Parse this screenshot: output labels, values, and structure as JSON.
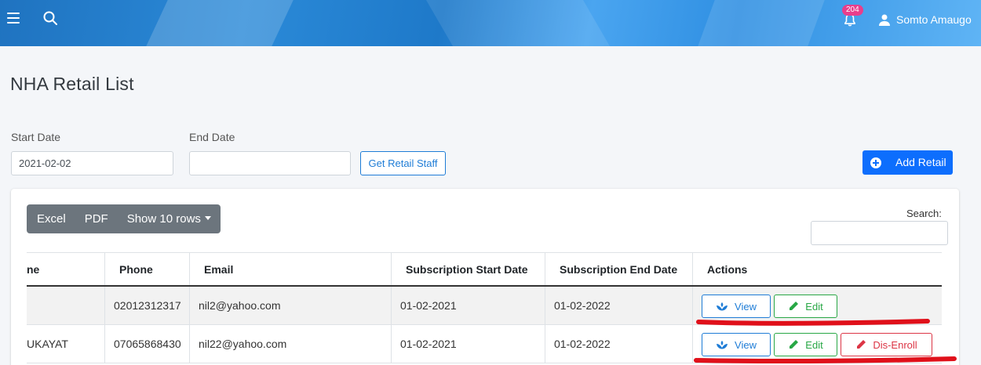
{
  "topbar": {
    "notification_count": "204",
    "user_name": "Somto Amaugo",
    "gradient_colors": [
      "#1f73c0",
      "#5fb4f5"
    ]
  },
  "page": {
    "title": "NHA Retail List"
  },
  "filters": {
    "start_label": "Start Date",
    "start_value": "2021-02-02",
    "end_label": "End Date",
    "end_value": "",
    "get_button": "Get Retail Staff",
    "add_button": "Add Retail"
  },
  "toolbar": {
    "excel": "Excel",
    "pdf": "PDF",
    "show_rows": "Show 10 rows",
    "search_label": "Search:"
  },
  "table": {
    "columns": [
      "ne",
      "Phone",
      "Email",
      "Subscription Start Date",
      "Subscription End Date",
      "Actions"
    ],
    "rows": [
      {
        "name": "",
        "phone": "02012312317",
        "email": "nil2@yahoo.com",
        "start": "01-02-2021",
        "end": "01-02-2022",
        "actions": [
          "View",
          "Edit"
        ]
      },
      {
        "name": "UKAYAT",
        "phone": "07065868430",
        "email": "nil22@yahoo.com",
        "start": "01-02-2021",
        "end": "01-02-2022",
        "actions": [
          "View",
          "Edit",
          "Dis-Enroll"
        ]
      }
    ]
  },
  "colors": {
    "primary": "#0d6efd",
    "view": "#1e7cd6",
    "edit": "#28a745",
    "danger": "#dc3545",
    "annotation": "#e0101a",
    "badge": "#e83e8c"
  }
}
